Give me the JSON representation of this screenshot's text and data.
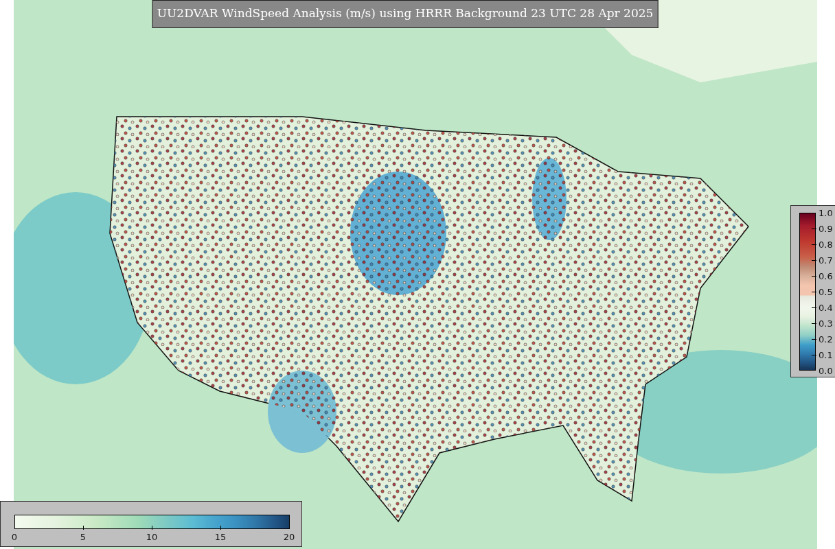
{
  "title": "UU2DVAR WindSpeed Analysis (m/s) using HRRR Background 23 UTC 28 Apr 2025",
  "colorbars": [
    {
      "kind": "vertical",
      "ticks": [
        "1.0",
        "0.9",
        "0.8",
        "0.7",
        "0.6",
        "0.5",
        "0.4",
        "0.3",
        "0.2",
        "0.1",
        "0.0"
      ]
    },
    {
      "kind": "horizontal",
      "ticks": [
        "0",
        "5",
        "10",
        "15",
        "20"
      ]
    }
  ]
}
